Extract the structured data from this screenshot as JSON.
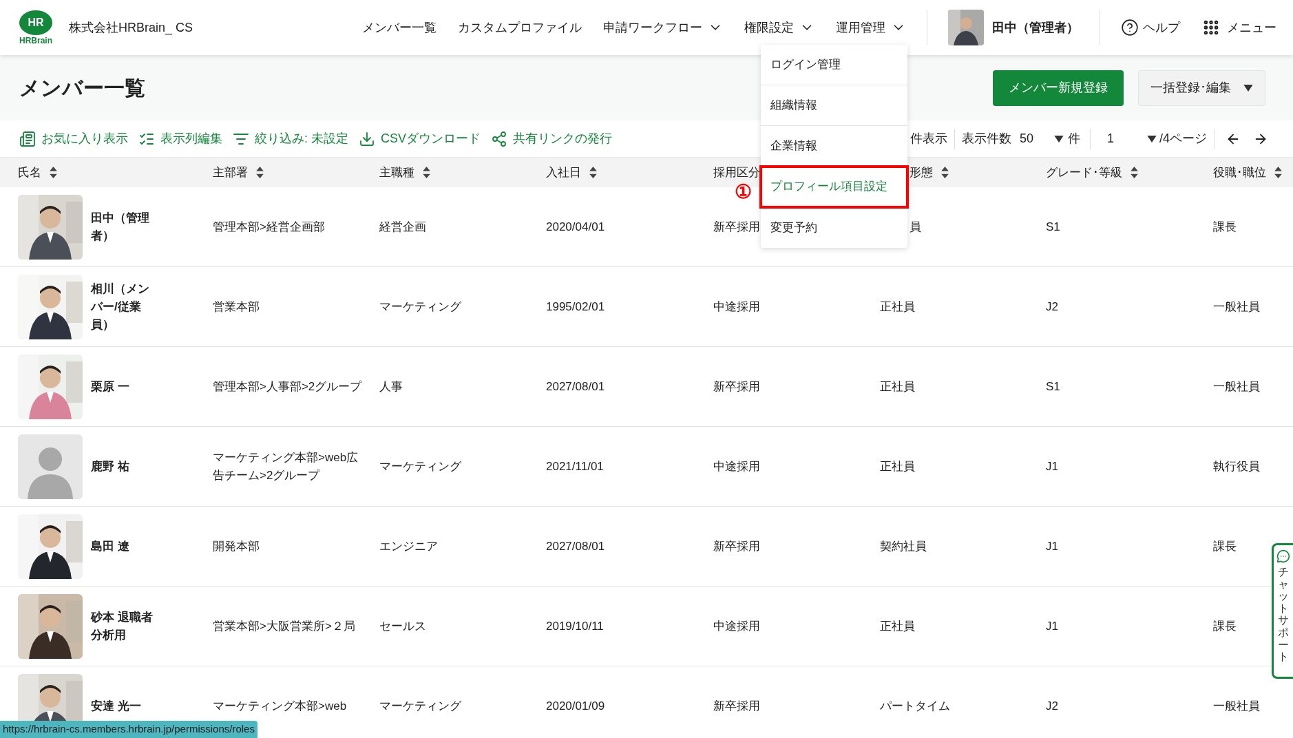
{
  "header": {
    "logo": {
      "mark": "HR",
      "word": "HRBrain"
    },
    "company": "株式会社HRBrain_ CS",
    "nav": [
      {
        "label": "メンバー一覧",
        "kind": "link"
      },
      {
        "label": "カスタムプロファイル",
        "kind": "link"
      },
      {
        "label": "申請ワークフロー",
        "kind": "dropdown"
      },
      {
        "label": "権限設定",
        "kind": "dropdown"
      },
      {
        "label": "運用管理",
        "kind": "dropdown"
      }
    ],
    "user": "田中（管理者）",
    "help": "ヘルプ",
    "menu": "メニュー"
  },
  "dropdown_menu": {
    "items": [
      {
        "label": "ログイン管理",
        "selected": false,
        "highlighted": false
      },
      {
        "label": "組織情報",
        "selected": false,
        "highlighted": false
      },
      {
        "label": "企業情報",
        "selected": false,
        "highlighted": false
      },
      {
        "label": "プロフィール項目設定",
        "selected": true,
        "highlighted": true
      },
      {
        "label": "変更予約",
        "selected": false,
        "highlighted": false
      }
    ],
    "annotation": "①"
  },
  "page_title": "メンバー一覧",
  "actions": {
    "primary": "メンバー新規登録",
    "bulk": "一括登録･編集"
  },
  "toolbar": [
    {
      "label": "お気に入り表示",
      "kind": "favorites"
    },
    {
      "label": "表示列編集",
      "kind": "columns"
    },
    {
      "label": "絞り込み: 未設定",
      "kind": "filter"
    },
    {
      "label": "CSVダウンロード",
      "kind": "download"
    },
    {
      "label": "共有リンクの発行",
      "kind": "share"
    }
  ],
  "pagination": {
    "count_text": "件表示",
    "per_page_label": "表示件数",
    "per_page": "50",
    "per_page_unit": "件",
    "page": "1",
    "page_total": "/4ページ"
  },
  "table": {
    "columns": [
      {
        "label": "氏名",
        "sortable": true,
        "partial": false
      },
      {
        "label": "主部署",
        "sortable": true,
        "partial": false
      },
      {
        "label": "主職種",
        "sortable": true,
        "partial": false
      },
      {
        "label": "入社日",
        "sortable": true,
        "partial": false
      },
      {
        "label": "採用区分",
        "partial": false
      },
      {
        "label": "形態",
        "sortable": true,
        "partial": true
      },
      {
        "label": "グレード･等級",
        "sortable": true,
        "partial": false
      },
      {
        "label": "役職･職位",
        "sortable": true,
        "partial": false
      }
    ],
    "rows": [
      {
        "default_avatar": false,
        "cells": [
          {
            "text": "田中（管理者）"
          },
          {
            "text": "管理本部>経営企画部"
          },
          {
            "text": "経営企画"
          },
          {
            "text": "2020/04/01"
          },
          {
            "text": "新卒採用"
          },
          {
            "text": "員",
            "partial": true
          },
          {
            "text": "S1"
          },
          {
            "text": "課長"
          }
        ]
      },
      {
        "default_avatar": false,
        "cells": [
          {
            "text": "相川（メンバー/従業員）"
          },
          {
            "text": "営業本部"
          },
          {
            "text": "マーケティング"
          },
          {
            "text": "1995/02/01"
          },
          {
            "text": "中途採用"
          },
          {
            "text": "正社員"
          },
          {
            "text": "J2"
          },
          {
            "text": "一般社員"
          }
        ]
      },
      {
        "default_avatar": false,
        "cells": [
          {
            "text": "栗原 一"
          },
          {
            "text": "管理本部>人事部>2グループ"
          },
          {
            "text": "人事"
          },
          {
            "text": "2027/08/01"
          },
          {
            "text": "新卒採用"
          },
          {
            "text": "正社員"
          },
          {
            "text": "S1"
          },
          {
            "text": "一般社員"
          }
        ]
      },
      {
        "default_avatar": true,
        "cells": [
          {
            "text": "鹿野 祐"
          },
          {
            "text": "マーケティング本部>web広告チーム>2グループ"
          },
          {
            "text": "マーケティング"
          },
          {
            "text": "2021/11/01"
          },
          {
            "text": "中途採用"
          },
          {
            "text": "正社員"
          },
          {
            "text": "J1"
          },
          {
            "text": "執行役員"
          }
        ]
      },
      {
        "default_avatar": false,
        "cells": [
          {
            "text": "島田 遼"
          },
          {
            "text": "開発本部"
          },
          {
            "text": "エンジニア"
          },
          {
            "text": "2027/08/01"
          },
          {
            "text": "新卒採用"
          },
          {
            "text": "契約社員"
          },
          {
            "text": "J1"
          },
          {
            "text": "課長"
          }
        ]
      },
      {
        "default_avatar": false,
        "cells": [
          {
            "text": "砂本 退職者分析用"
          },
          {
            "text": "営業本部>大阪営業所>２局"
          },
          {
            "text": "セールス"
          },
          {
            "text": "2019/10/11"
          },
          {
            "text": "中途採用"
          },
          {
            "text": "正社員"
          },
          {
            "text": "J1"
          },
          {
            "text": "課長"
          }
        ]
      },
      {
        "default_avatar": false,
        "cells": [
          {
            "text": "安達 光一"
          },
          {
            "text": "マーケティング本部>web"
          },
          {
            "text": "マーケティング"
          },
          {
            "text": "2020/01/09"
          },
          {
            "text": "新卒採用"
          },
          {
            "text": "パートタイム"
          },
          {
            "text": "J2"
          },
          {
            "text": "一般社員"
          }
        ]
      }
    ]
  },
  "status_bar": "https://hrbrain-cs.members.hrbrain.jp/permissions/roles",
  "chat_support": "チャットサポート"
}
